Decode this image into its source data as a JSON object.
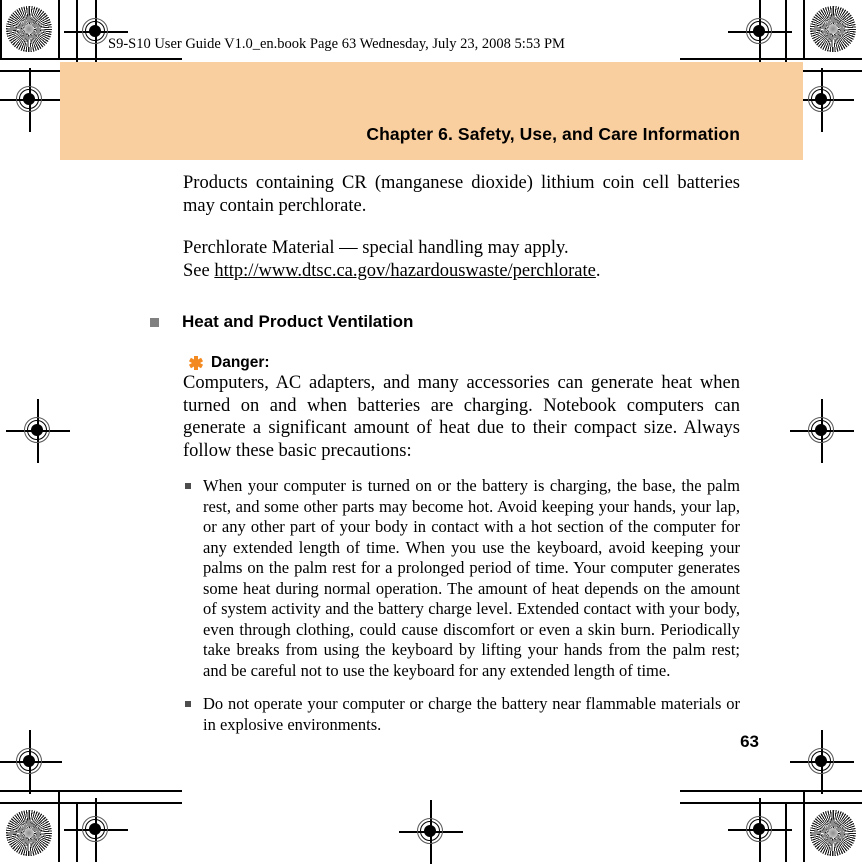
{
  "page": {
    "header_stamp": "S9-S10 User Guide V1.0_en.book  Page 63  Wednesday, July 23, 2008  5:53 PM",
    "page_number": "63",
    "chapter_title": "Chapter 6. Safety, Use, and Care Information",
    "band_color": "#facfa0",
    "heading_bullet_color": "#808080",
    "danger_icon_color": "#f28a21"
  },
  "body": {
    "paragraph_1": "Products containing CR (manganese dioxide) lithium coin cell batteries may contain perchlorate.",
    "paragraph_2_line_1": "Perchlorate Material — special handling may apply.",
    "paragraph_2_prefix": "See ",
    "paragraph_2_url": "http://www.dtsc.ca.gov/hazardouswaste/perchlorate",
    "paragraph_2_suffix": ".",
    "section_heading": "Heat and Product Ventilation",
    "danger_label": "Danger:",
    "danger_paragraph": "Computers, AC adapters, and many accessories can generate heat when turned on and when batteries are charging. Notebook computers can generate a significant amount of heat due to their compact size. Always follow these basic precautions:",
    "bullets": [
      "When your computer is turned on or the battery is charging, the base, the palm rest, and some other parts may become hot. Avoid keeping your hands, your lap, or any other part of your body in contact with a hot section of the computer for any extended length of time. When you use the keyboard, avoid keeping your palms on the palm rest for a prolonged period of time. Your computer generates some heat during normal operation. The amount of heat depends on the amount of system activity and the battery charge level. Extended contact with your body, even through clothing, could cause discomfort or even a skin burn. Periodically take breaks from using the keyboard by lifting your hands from the palm rest; and be careful not to use the keyboard for any extended length of time.",
      "Do not operate your computer or charge the battery near flammable materials or in explosive environments."
    ]
  }
}
